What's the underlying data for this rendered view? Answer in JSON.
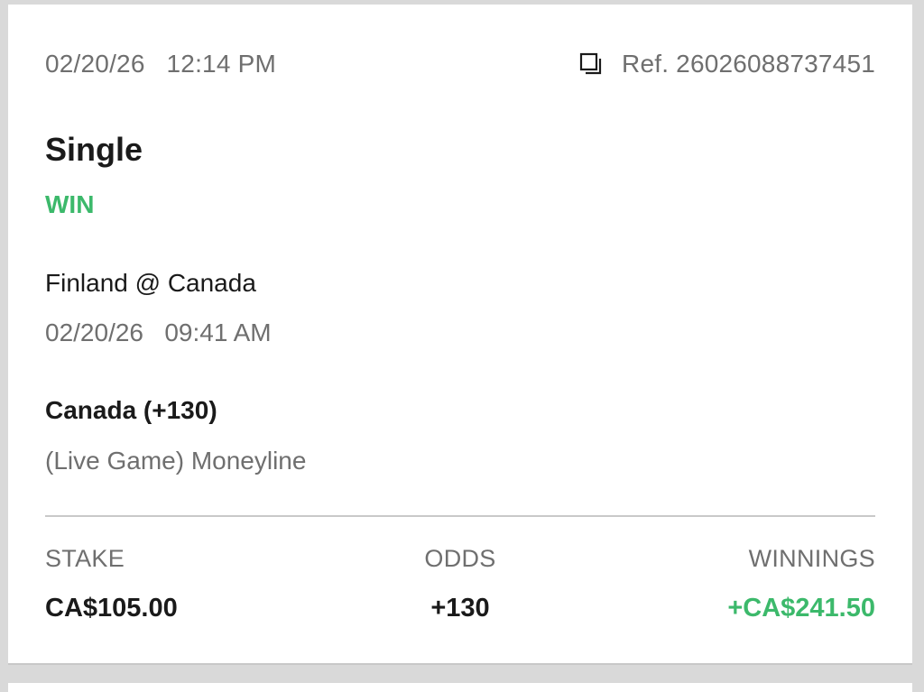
{
  "bet": {
    "placed_at": "02/20/26   12:14 PM",
    "ref_label": "Ref. 26026088737451",
    "copy_icon": "copy-icon",
    "type": "Single",
    "status": "WIN",
    "status_color": "#3cb96b",
    "event_name": "Finland @ Canada",
    "event_time": "02/20/26   09:41 AM",
    "selection": "Canada (+130)",
    "market": "(Live Game) Moneyline"
  },
  "summary": {
    "stake_label": "STAKE",
    "stake_value": "CA$105.00",
    "odds_label": "ODDS",
    "odds_value": "+130",
    "winnings_label": "WINNINGS",
    "winnings_value": "+CA$241.50",
    "winnings_color": "#3cb96b"
  }
}
